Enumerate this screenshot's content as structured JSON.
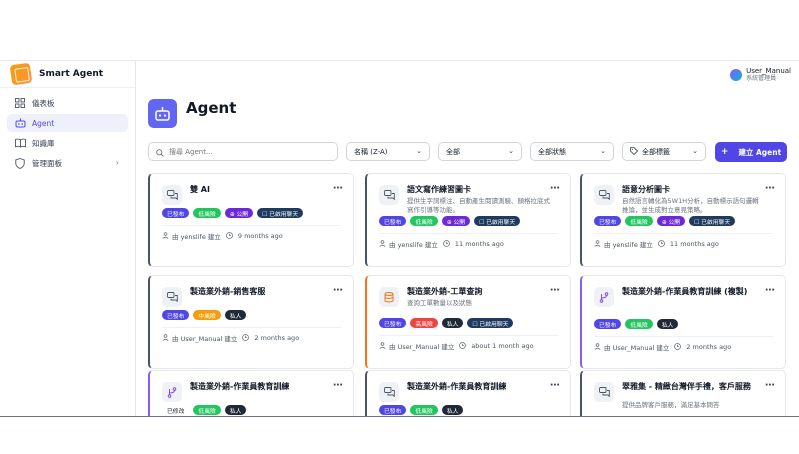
{
  "app": {
    "name": "Smart Agent"
  },
  "user": {
    "name": "User_Manual",
    "role": "系統管理員"
  },
  "sidebar": {
    "items": [
      {
        "label": "儀表板",
        "icon": "dashboard-icon"
      },
      {
        "label": "Agent",
        "icon": "bot-icon"
      },
      {
        "label": "知識庫",
        "icon": "book-icon"
      },
      {
        "label": "管理面板",
        "icon": "shield-icon"
      }
    ]
  },
  "page": {
    "title": "Agent"
  },
  "filters": {
    "search_placeholder": "搜尋 Agent...",
    "sort_value": "名稱 (Z-A)",
    "category_value": "全部",
    "status_value": "全部狀態",
    "tag_value": "全部標籤",
    "create_label": "建立 Agent"
  },
  "colors": {
    "accent": "#4f46e5",
    "published": "#4f46e5",
    "low_risk": "#22c55e",
    "mid_risk": "#f59e0b",
    "high_risk": "#ef4444",
    "public": "#6d28d9",
    "enabled_chat": "#1e3a5f",
    "private": "#1f2937",
    "modified": "#ffffff"
  },
  "cards": [
    {
      "title": "雙 AI",
      "desc": "",
      "badges": [
        "已發布",
        "低風險",
        "⊕ 公開",
        "☐ 已啟用聊天"
      ],
      "author": "由 yenslife 建立",
      "time": "9 months ago"
    },
    {
      "title": "語文寫作練習圖卡",
      "desc": "提供生字詞標注、自動產生閱讀測驗、顏格拉底式寫作引導等功能。",
      "badges": [
        "已發布",
        "低風險",
        "⊕ 公開",
        "☐ 已啟用聊天"
      ],
      "author": "由 yenslife 建立",
      "time": "11 months ago"
    },
    {
      "title": "語意分析圖卡",
      "desc": "自然語言轉化為5W1H分析，自動標示語句邏輯推論，並生成對立意見策略。",
      "badges": [
        "已發布",
        "低風險",
        "⊕ 公開",
        "☐ 已啟用聊天"
      ],
      "author": "由 yenslife 建立",
      "time": "11 months ago"
    },
    {
      "title": "製造業外銷-銷售客服",
      "desc": "",
      "badges": [
        "已發布",
        "中風險",
        "私人"
      ],
      "author": "由 User_Manual 建立",
      "time": "2 months ago"
    },
    {
      "title": "製造業外銷-工單查詢",
      "desc": "查詢工單數量以及狀態",
      "badges": [
        "已發布",
        "高風險",
        "私人",
        "☐ 已啟用聊天"
      ],
      "author": "由 User_Manual 建立",
      "time": "about 1 month ago"
    },
    {
      "title": "製造業外銷-作業員教育訓練 (複製)",
      "desc": "",
      "badges": [
        "已發布",
        "低風險",
        "私人"
      ],
      "author": "由 User_Manual 建立",
      "time": "2 months ago"
    },
    {
      "title": "製造業外銷-作業員教育訓練",
      "desc": "",
      "badges": [
        "已修改",
        "低風險",
        "私人"
      ],
      "author": "",
      "time": ""
    },
    {
      "title": "製造業外銷-作業員教育訓練",
      "desc": "",
      "badges": [
        "已發布",
        "低風險",
        "私人"
      ],
      "author": "",
      "time": ""
    },
    {
      "title": "翠雅集 - 精緻台灣伴手禮，客戶服務",
      "desc": "提供品牌客戶服務，滿足基本問答",
      "badges": [],
      "author": "",
      "time": ""
    }
  ]
}
